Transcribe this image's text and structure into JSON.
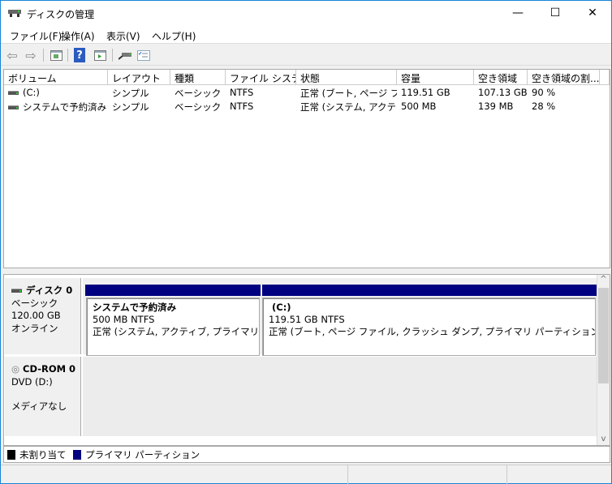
{
  "window": {
    "title": "ディスクの管理",
    "minimize": "—",
    "maximize": "☐",
    "close": "✕"
  },
  "menu": [
    "ファイル(F)",
    "操作(A)",
    "表示(V)",
    "ヘルプ(H)"
  ],
  "toolbar": {
    "back": "⇦",
    "forward": "⇨",
    "help": "?"
  },
  "columns": [
    "ボリューム",
    "レイアウト",
    "種類",
    "ファイル システム",
    "状態",
    "容量",
    "空き領域",
    "空き領域の割..."
  ],
  "volumes": [
    {
      "name": "(C:)",
      "layout": "シンプル",
      "type": "ベーシック",
      "fs": "NTFS",
      "status": "正常 (ブート, ページ フ...",
      "capacity": "119.51 GB",
      "free": "107.13 GB",
      "pct": "90 %"
    },
    {
      "name": "システムで予約済み",
      "layout": "シンプル",
      "type": "ベーシック",
      "fs": "NTFS",
      "status": "正常 (システム, アクテ...",
      "capacity": "500 MB",
      "free": "139 MB",
      "pct": "28 %"
    }
  ],
  "disks": [
    {
      "name": "ディスク 0",
      "kind": "ベーシック",
      "size": "120.00 GB",
      "state": "オンライン",
      "partitions": [
        {
          "name": "システムで予約済み",
          "size": "500 MB NTFS",
          "status": "正常 (システム, アクティブ, プライマリ パーティ"
        },
        {
          "name": "(C:)",
          "size": "119.51 GB NTFS",
          "status": "正常 (ブート, ページ ファイル, クラッシュ ダンプ, プライマリ パーティション)"
        }
      ]
    },
    {
      "name": "CD-ROM 0",
      "kind": "DVD (D:)",
      "state": "メディアなし"
    }
  ],
  "legend": [
    {
      "label": "未割り当て",
      "color": "#000000"
    },
    {
      "label": "プライマリ パーティション",
      "color": "#000080"
    }
  ],
  "scroll": {
    "up": "^",
    "down": "v"
  }
}
